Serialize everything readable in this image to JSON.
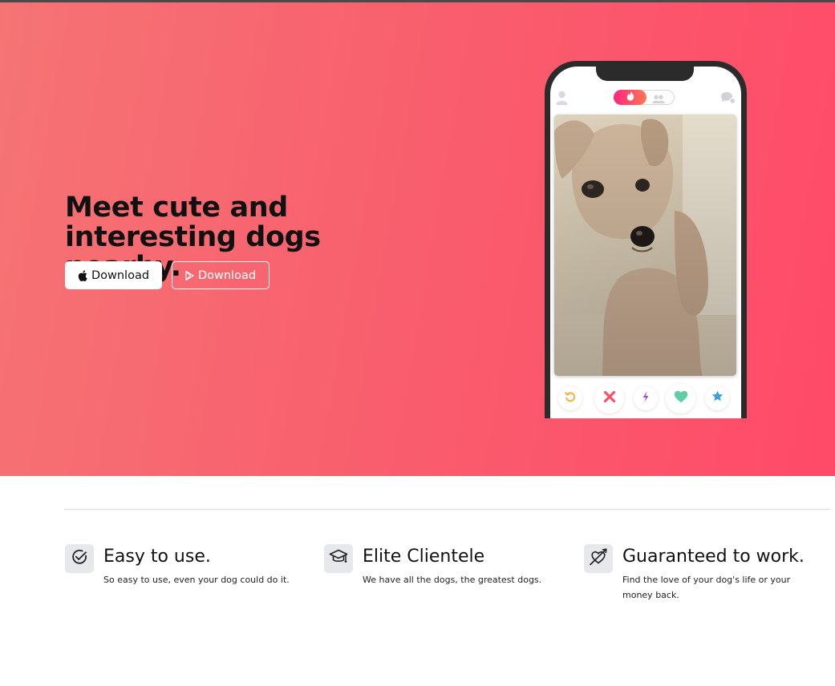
{
  "hero": {
    "title": "Meet cute and interesting dogs nearby.",
    "apple_button_label": "Download",
    "play_button_label": "Download",
    "background_start": "#f57474",
    "background_end": "#ff4a68"
  },
  "phone_mockup": {
    "icons": [
      "profile-icon",
      "flame-icon",
      "group-icon",
      "chat-icon",
      "rewind-icon",
      "nope-icon",
      "boost-icon",
      "like-icon",
      "super-like-icon"
    ],
    "accent": "#fd267d"
  },
  "features": [
    {
      "icon": "check-circle-icon",
      "title": "Easy to use.",
      "text": "So easy to use, even your dog could do it."
    },
    {
      "icon": "graduation-cap-icon",
      "title": "Elite Clientele",
      "text": "We have all the dogs, the greatest dogs."
    },
    {
      "icon": "heart-arrow-icon",
      "title": "Guaranteed to work.",
      "text": "Find the love of your dog's life or your money back."
    }
  ]
}
